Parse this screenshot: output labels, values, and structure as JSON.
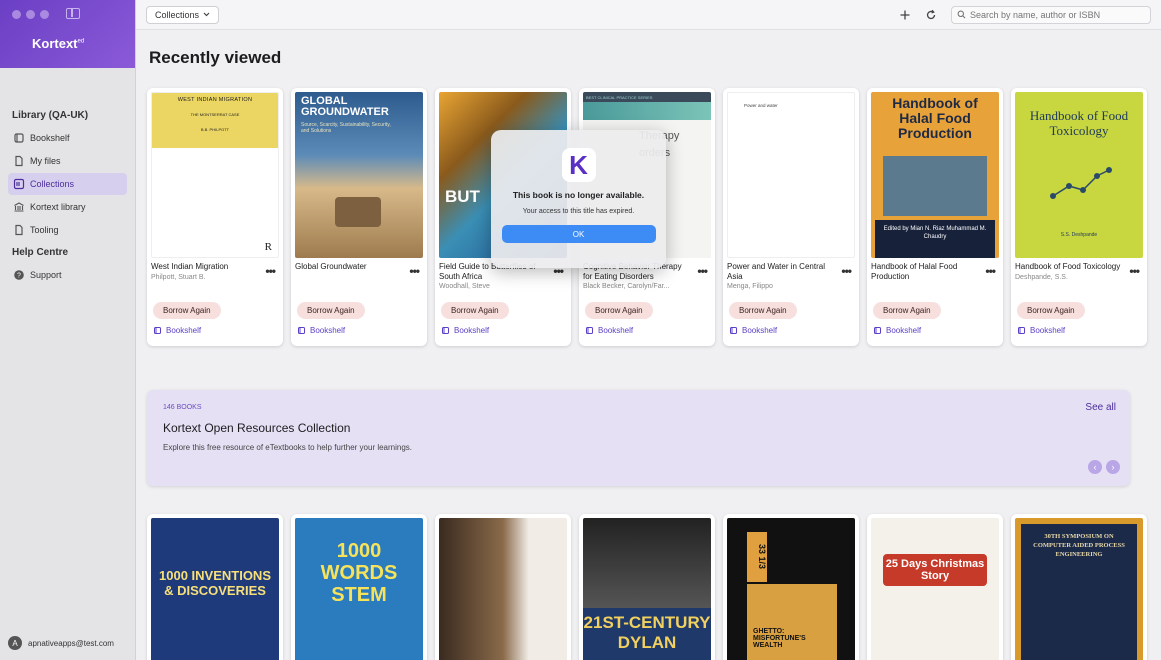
{
  "app": {
    "brand": "Kortext",
    "brand_sup": "ed"
  },
  "sidebar": {
    "library_heading": "Library (QA-UK)",
    "items": [
      {
        "label": "Bookshelf",
        "icon": "bookshelf-icon"
      },
      {
        "label": "My files",
        "icon": "files-icon"
      },
      {
        "label": "Collections",
        "icon": "collections-icon",
        "active": true
      },
      {
        "label": "Kortext library",
        "icon": "library-icon"
      },
      {
        "label": "Tooling",
        "icon": "tooling-icon"
      }
    ],
    "help_heading": "Help Centre",
    "help_items": [
      {
        "label": "Support",
        "icon": "help-circle-icon"
      }
    ],
    "user_initial": "A",
    "user_email": "apnativeapps@test.com"
  },
  "topbar": {
    "dropdown": "Collections",
    "search_placeholder": "Search by name, author or ISBN"
  },
  "recent": {
    "title": "Recently viewed",
    "borrow_label": "Borrow Again",
    "shelf_label": "Bookshelf",
    "books": [
      {
        "title": "West Indian Migration",
        "author": "Philpott, Stuart B.",
        "cover_title": "WEST INDIAN MIGRATION",
        "cover_sub": "THE MONTSERRAT CASE",
        "cover_author": "B.B. PHILPOTT",
        "mark": "R"
      },
      {
        "title": "Global Groundwater",
        "author": "",
        "cover_title": "GLOBAL GROUNDWATER",
        "cover_sub": "Source, Scarcity, Sustainability, Security, and Solutions"
      },
      {
        "title": "Field Guide to Butterflies of South Africa",
        "author": "Woodhall, Steve",
        "cover_title": "BUT"
      },
      {
        "title": "Cognitive Behavior Therapy for Eating Disorders",
        "author": "Black Becker, Carolyn/Far...",
        "cover_banner": "BEST CLINICAL PRACTICE SERIES",
        "cover_title": "Therapy orders"
      },
      {
        "title": "Power and Water in Central Asia",
        "author": "Menga, Filippo",
        "cover_title": "Power and water"
      },
      {
        "title": "Handbook of Halal Food Production",
        "author": "",
        "cover_title": "Handbook of Halal Food Production",
        "cover_author": "Edited by Mian N. Riaz Muhammad M. Chaudry"
      },
      {
        "title": "Handbook of Food Toxicology",
        "author": "Deshpande, S.S.",
        "cover_title": "Handbook of Food Toxicology",
        "cover_author": "S.S. Deshpande"
      }
    ]
  },
  "promo": {
    "count": "146 BOOKS",
    "title": "Kortext Open Resources Collection",
    "desc": "Explore this free resource of eTextbooks to help further your learnings.",
    "see_all": "See all",
    "prev": "‹",
    "next": "›"
  },
  "row2": {
    "books": [
      {
        "cover_title": "1000 INVENTIONS & DISCOVERIES"
      },
      {
        "cover_title": "1000 WORDS STEM"
      },
      {
        "cover_title": ""
      },
      {
        "cover_title": "21ST-CENTURY DYLAN"
      },
      {
        "cover_title": "GHETTO: MISFORTUNE'S WEALTH",
        "cover_sub": "33 1/3"
      },
      {
        "cover_title": "25 Days Christmas Story"
      },
      {
        "cover_title": "30TH SYMPOSIUM ON COMPUTER AIDED PROCESS ENGINEERING"
      }
    ]
  },
  "modal": {
    "logo": "K",
    "title": "This book is no longer available.",
    "text": "Your access to this title has expired.",
    "ok": "OK"
  }
}
